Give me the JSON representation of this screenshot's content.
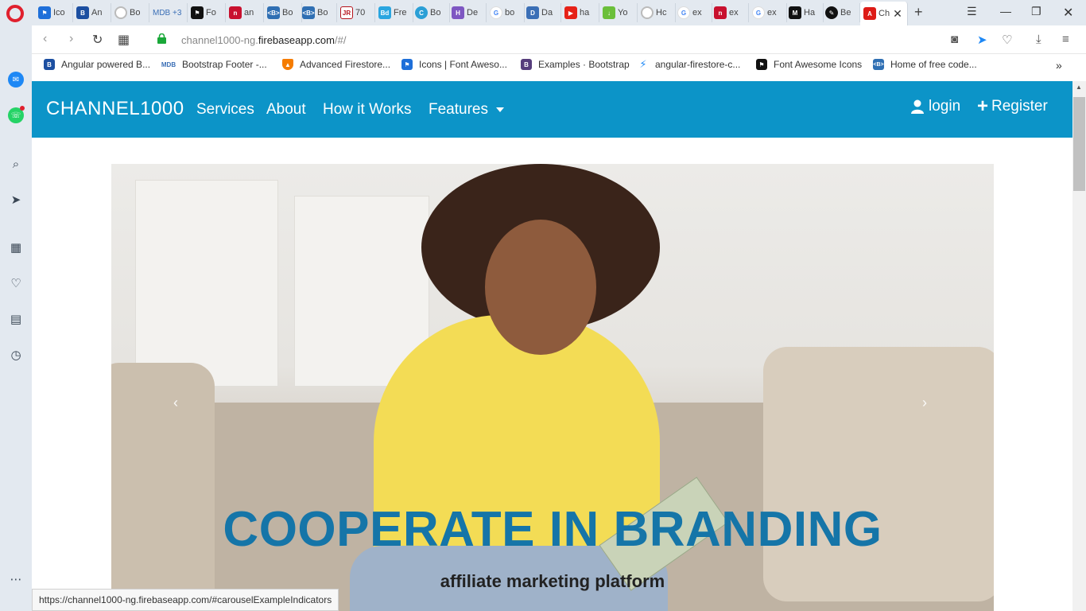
{
  "tabs": [
    {
      "icon": "flag-icon",
      "title": "Ico"
    },
    {
      "icon": "shield-b-icon",
      "title": "An"
    },
    {
      "icon": "loading-icon",
      "title": "Bo"
    },
    {
      "icon": "mdb-icon",
      "title": "MDB +3"
    },
    {
      "icon": "flag-black-icon",
      "title": "Fo"
    },
    {
      "icon": "red-square-icon",
      "title": "an"
    },
    {
      "icon": "bootstrap-b-icon",
      "title": "Bo"
    },
    {
      "icon": "bootstrap-b-icon",
      "title": "Bo"
    },
    {
      "icon": "jr-icon",
      "title": "70"
    },
    {
      "icon": "bd-icon",
      "title": "Fre"
    },
    {
      "icon": "c-icon",
      "title": "Bo"
    },
    {
      "icon": "h-icon",
      "title": "De"
    },
    {
      "icon": "google-icon",
      "title": "bo"
    },
    {
      "icon": "d-icon",
      "title": "Da"
    },
    {
      "icon": "youtube-icon",
      "title": "ha"
    },
    {
      "icon": "download-arrow-icon",
      "title": "Yo"
    },
    {
      "icon": "loading-icon",
      "title": "Hc"
    },
    {
      "icon": "google-icon",
      "title": "ex"
    },
    {
      "icon": "red-square-icon",
      "title": "ex"
    },
    {
      "icon": "google-icon",
      "title": "ex"
    },
    {
      "icon": "medium-icon",
      "title": "Ha"
    },
    {
      "icon": "pen-icon",
      "title": "Be"
    },
    {
      "icon": "angular-icon",
      "title": "Ch"
    }
  ],
  "address": {
    "url_prefix": "channel1000-ng.",
    "url_host": "firebaseapp.com",
    "url_suffix": "/#/"
  },
  "bookmarks": [
    {
      "icon": "angular-shield-icon",
      "label": "Angular powered B..."
    },
    {
      "icon": "mdb-icon",
      "label": "Bootstrap Footer -..."
    },
    {
      "icon": "firebase-icon",
      "label": "Advanced Firestore..."
    },
    {
      "icon": "flag-icon",
      "label": "Icons | Font Aweso..."
    },
    {
      "icon": "bootstrap-b-icon",
      "label": "Examples · Bootstrap"
    },
    {
      "icon": "lightning-icon",
      "label": "angular-firestore-c..."
    },
    {
      "icon": "flag-black-icon",
      "label": "Font Awesome Icons"
    },
    {
      "icon": "bootstrap-b-icon",
      "label": "Home of free code..."
    }
  ],
  "site": {
    "brand": "CHANNEL1000",
    "nav": [
      "Services",
      "About",
      "How it Works",
      "Features"
    ],
    "login": "login",
    "register": "Register"
  },
  "carousel": {
    "headline": "COOPERATE IN BRANDING",
    "subline": "affiliate marketing platform",
    "prev": "‹",
    "next": "›"
  },
  "status_url": "https://channel1000-ng.firebaseapp.com/#carouselExampleIndicators",
  "colors": {
    "navbar": "#0c94c8",
    "headline": "#1575a8",
    "browser_chrome": "#e3e9f0"
  }
}
